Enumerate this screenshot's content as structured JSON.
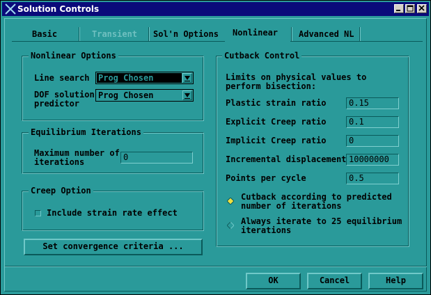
{
  "window": {
    "title": "Solution Controls"
  },
  "tabs": [
    {
      "label": "Basic",
      "state": "normal"
    },
    {
      "label": "Transient",
      "state": "disabled"
    },
    {
      "label": "Sol'n Options",
      "state": "normal"
    },
    {
      "label": "Nonlinear",
      "state": "selected"
    },
    {
      "label": "Advanced NL",
      "state": "normal"
    }
  ],
  "nonlinear_options": {
    "title": "Nonlinear Options",
    "line_search_label": "Line search",
    "line_search_value": "Prog Chosen",
    "dof_label": "DOF solution\npredictor",
    "dof_value": "Prog Chosen"
  },
  "equilibrium": {
    "title": "Equilibrium Iterations",
    "max_label": "Maximum number of\niterations",
    "max_value": "0"
  },
  "creep": {
    "title": "Creep Option",
    "strain_rate_label": "Include strain rate effect",
    "strain_rate_checked": false
  },
  "convergence_button": "Set convergence criteria ...",
  "cutback": {
    "title": "Cutback Control",
    "intro": "Limits on physical values to\nperform bisection:",
    "fields": [
      {
        "label": "Plastic strain ratio",
        "value": "0.15"
      },
      {
        "label": "Explicit Creep ratio",
        "value": "0.1"
      },
      {
        "label": "Implicit Creep ratio",
        "value": "0"
      },
      {
        "label": "Incremental displacement",
        "value": "10000000"
      },
      {
        "label": "Points per cycle",
        "value": "0.5"
      }
    ],
    "options": [
      {
        "label": "Cutback according to predicted\nnumber of iterations",
        "selected": true
      },
      {
        "label": "Always iterate to 25 equilibrium\niterations",
        "selected": false
      }
    ]
  },
  "buttons": {
    "ok": "OK",
    "cancel": "Cancel",
    "help": "Help"
  },
  "colors": {
    "background": "#2a9a9a",
    "titlebar": "#0a0a7a",
    "radio_selected": "#f0e040"
  }
}
